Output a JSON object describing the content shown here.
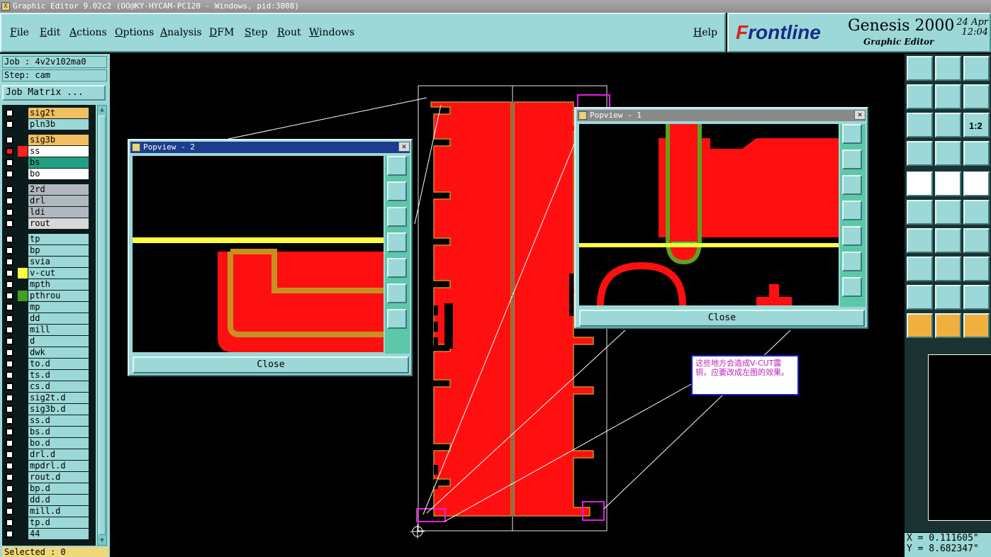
{
  "window": {
    "title": "Graphic Editor 9.02c2 (OO@KY-HYCAM-PC120 - Windows, pid:3808)"
  },
  "menu": {
    "items": [
      "File",
      "Edit",
      "Actions",
      "Options",
      "Analysis",
      "DFM",
      "Step",
      "Rout",
      "Windows"
    ],
    "help": "Help"
  },
  "logo": {
    "brand_a": "F",
    "brand_b": "rontline",
    "product": "Genesis 2000",
    "subtitle": "Graphic Editor",
    "date_line1": "24 Apr",
    "date_line2": "12:04"
  },
  "job": {
    "job_label": "Job : 4v2v102ma0",
    "step_label": "Step: cam",
    "matrix_button": "Job Matrix ..."
  },
  "layers": [
    {
      "name": "sig2t",
      "bg": "#f0c060",
      "swatch": "#0b1a1a"
    },
    {
      "name": "pln3b",
      "bg": "#9cd8d8",
      "swatch": "#0b1a1a"
    },
    {
      "name": "sig3b",
      "bg": "#f0c060",
      "swatch": "#0b1a1a"
    },
    {
      "name": "ss",
      "bg": "#ffffff",
      "swatch": "#ff2020",
      "active": true
    },
    {
      "name": "bs",
      "bg": "#20a080",
      "swatch": "#0b1a1a"
    },
    {
      "name": "bo",
      "bg": "#ffffff",
      "swatch": "#0b1a1a"
    },
    {
      "name": "2rd",
      "bg": "#b0b8c0",
      "swatch": "#0b1a1a"
    },
    {
      "name": "drl",
      "bg": "#b0b8c0",
      "swatch": "#0b1a1a"
    },
    {
      "name": "ldi",
      "bg": "#b0b8c0",
      "swatch": "#0b1a1a"
    },
    {
      "name": "rout",
      "bg": "#d8d8d8",
      "swatch": "#0b1a1a"
    },
    {
      "name": "tp",
      "bg": "#9cd8d8",
      "swatch": "#0b1a1a"
    },
    {
      "name": "bp",
      "bg": "#9cd8d8",
      "swatch": "#0b1a1a"
    },
    {
      "name": "svia",
      "bg": "#9cd8d8",
      "swatch": "#0b1a1a"
    },
    {
      "name": "v-cut",
      "bg": "#9cd8d8",
      "swatch": "#ffff40"
    },
    {
      "name": "mpth",
      "bg": "#9cd8d8",
      "swatch": "#0b1a1a"
    },
    {
      "name": "pthrou",
      "bg": "#9cd8d8",
      "swatch": "#40a020"
    },
    {
      "name": "mp",
      "bg": "#9cd8d8",
      "swatch": "#0b1a1a"
    },
    {
      "name": "dd",
      "bg": "#9cd8d8",
      "swatch": "#0b1a1a"
    },
    {
      "name": "mill",
      "bg": "#9cd8d8",
      "swatch": "#0b1a1a"
    },
    {
      "name": "d",
      "bg": "#9cd8d8",
      "swatch": "#0b1a1a"
    },
    {
      "name": "dwk",
      "bg": "#9cd8d8",
      "swatch": "#0b1a1a"
    },
    {
      "name": "to.d",
      "bg": "#9cd8d8",
      "swatch": "#0b1a1a"
    },
    {
      "name": "ts.d",
      "bg": "#9cd8d8",
      "swatch": "#0b1a1a"
    },
    {
      "name": "cs.d",
      "bg": "#9cd8d8",
      "swatch": "#0b1a1a"
    },
    {
      "name": "sig2t.d",
      "bg": "#9cd8d8",
      "swatch": "#0b1a1a"
    },
    {
      "name": "sig3b.d",
      "bg": "#9cd8d8",
      "swatch": "#0b1a1a"
    },
    {
      "name": "ss.d",
      "bg": "#9cd8d8",
      "swatch": "#0b1a1a"
    },
    {
      "name": "bs.d",
      "bg": "#9cd8d8",
      "swatch": "#0b1a1a"
    },
    {
      "name": "bo.d",
      "bg": "#9cd8d8",
      "swatch": "#0b1a1a"
    },
    {
      "name": "drl.d",
      "bg": "#9cd8d8",
      "swatch": "#0b1a1a"
    },
    {
      "name": "mpdrl.d",
      "bg": "#9cd8d8",
      "swatch": "#0b1a1a"
    },
    {
      "name": "rout.d",
      "bg": "#9cd8d8",
      "swatch": "#0b1a1a"
    },
    {
      "name": "bp.d",
      "bg": "#9cd8d8",
      "swatch": "#0b1a1a"
    },
    {
      "name": "dd.d",
      "bg": "#9cd8d8",
      "swatch": "#0b1a1a"
    },
    {
      "name": "mill.d",
      "bg": "#9cd8d8",
      "swatch": "#0b1a1a"
    },
    {
      "name": "tp.d",
      "bg": "#9cd8d8",
      "swatch": "#0b1a1a"
    },
    {
      "name": "44",
      "bg": "#9cd8d8",
      "swatch": "#0b1a1a"
    }
  ],
  "status": {
    "selected": "Selected : 0"
  },
  "popview1": {
    "title": "Popview - 1",
    "close": "Close"
  },
  "popview2": {
    "title": "Popview - 2",
    "close": "Close"
  },
  "note": {
    "text": "这些地方会造成V-CUT露铜，应要改成左图的效果。"
  },
  "coords": {
    "x": "X = 0.111605\"",
    "y": "Y = 8.682347\""
  },
  "colors": {
    "panel": "#9cd8d8",
    "copper": "#ff1010",
    "vcut": "#ffff40",
    "outline": "#c89020",
    "accent": "#1b1bd0"
  }
}
